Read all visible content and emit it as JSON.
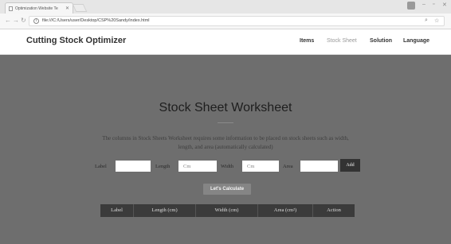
{
  "browser": {
    "tab_title": "Optimization Website Te",
    "url": "file:///C:/Users/user/Desktop/CSP%20Sandy/index.html",
    "icons": [
      "back-icon",
      "forward-icon",
      "reload-icon",
      "info-icon",
      "zoom-icon",
      "star-icon",
      "menu-icon"
    ]
  },
  "navbar": {
    "brand": "Cutting Stock Optimizer",
    "links": [
      "Items",
      "Stock Sheet",
      "Solution",
      "Language"
    ],
    "active_link": "Stock Sheet"
  },
  "section": {
    "title": "Stock Sheet Worksheet",
    "description": "The columns in Stock Sheets Worksheet requires some information to be placed on stock sheets such as width, length, and area (automatically calculated)"
  },
  "form": {
    "label_text": "Label",
    "length_text": "Length",
    "width_text": "Width",
    "area_text": "Area",
    "length_placeholder": "Cm",
    "width_placeholder": "Cm",
    "add_label": "Add",
    "calculate_label": "Let's Calculate"
  },
  "table": {
    "headers": [
      "Label",
      "Length (cm)",
      "Width (cm)",
      "Area (cm²)",
      "Action"
    ]
  },
  "colors": {
    "hero_bg": "#6e6e6e",
    "table_header_bg": "#3b3b3b",
    "button_dark": "#333333"
  }
}
